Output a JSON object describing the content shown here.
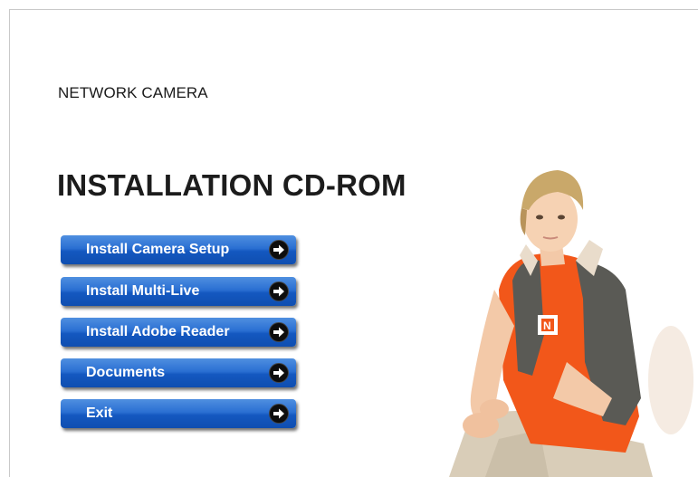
{
  "header": {
    "subtitle": "NETWORK CAMERA",
    "title": "INSTALLATION CD-ROM"
  },
  "menu": {
    "items": [
      {
        "label": "Install Camera Setup",
        "icon": "arrow-right-icon"
      },
      {
        "label": "Install Multi-Live",
        "icon": "arrow-right-icon"
      },
      {
        "label": "Install Adobe Reader",
        "icon": "arrow-right-icon"
      },
      {
        "label": "Documents",
        "icon": "arrow-right-icon"
      },
      {
        "label": "Exit",
        "icon": "arrow-right-icon"
      }
    ]
  },
  "colors": {
    "button_blue": "#1a5fc8",
    "shirt_orange": "#f2571a",
    "vest_gray": "#5a5a55"
  }
}
